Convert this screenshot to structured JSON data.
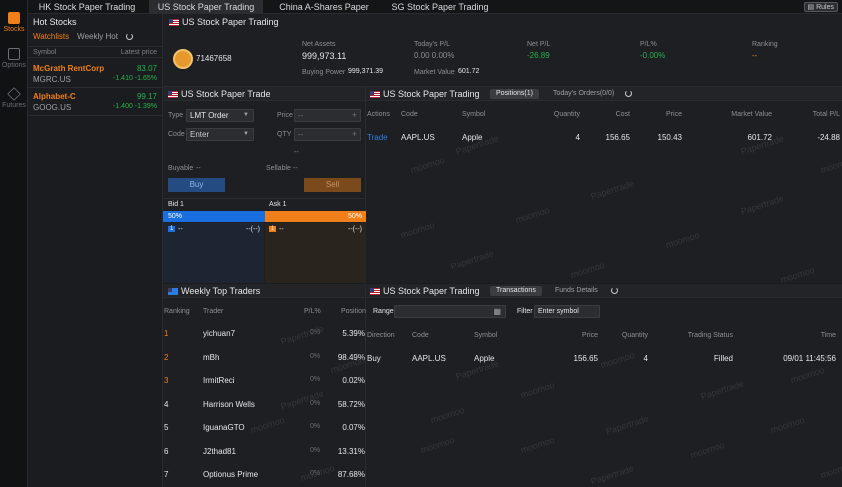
{
  "rail": [
    {
      "label": "Stocks",
      "icon": "stocks-icon",
      "active": true
    },
    {
      "label": "Options",
      "icon": "options-icon",
      "active": false
    },
    {
      "label": "Futures",
      "icon": "futures-icon",
      "active": false
    }
  ],
  "tabs": [
    "HK Stock Paper Trading",
    "US Stock Paper Trading",
    "China A-Shares Paper Trading",
    "SG Stock Paper Trading"
  ],
  "rules_label": "Rules",
  "hot": {
    "title": "Hot Stocks",
    "subtabs": [
      "Watchlists",
      "Weekly Hot"
    ],
    "col_symbol": "Symbol",
    "col_price": "Latest price",
    "stocks": [
      {
        "name": "McGrath RentCorp",
        "code": "MGRC.US",
        "price": "83.07",
        "change": "-1.410 -1.65%"
      },
      {
        "name": "Alphabet-C",
        "code": "GOOG.US",
        "price": "99.17",
        "change": "-1.400 -1.39%"
      }
    ]
  },
  "account": {
    "title": "US Stock Paper Trading",
    "id": "71467658",
    "net_assets_label": "Net Assets",
    "net_assets": "999,973.11",
    "buying_power_label": "Buying Power",
    "buying_power": "999,371.39",
    "todays_pl_label": "Today's P/L",
    "todays_pl": "0.00  0.00%",
    "market_value_label": "Market Value",
    "market_value": "601.72",
    "net_pl_label": "Net P/L",
    "net_pl": "-26.89",
    "pl_pct_label": "P/L%",
    "pl_pct": "-0.00%",
    "ranking_label": "Ranking",
    "ranking": "--"
  },
  "trade": {
    "title": "US Stock Paper Trade",
    "type_label": "Type",
    "type_value": "LMT Order",
    "code_label": "Code",
    "code_placeholder": "Enter",
    "price_label": "Price",
    "qty_label": "QTY",
    "price_value": "--",
    "qty_value": "--",
    "dash": "--",
    "buyable_label": "Buyable",
    "buyable": "--",
    "sellable_label": "Sellable",
    "sellable": "--",
    "buy": "Buy",
    "sell": "Sell",
    "bid_label": "Bid 1",
    "ask_label": "Ask 1",
    "bid_pct": "50%",
    "ask_pct": "50%",
    "bid_ratio": 0.5,
    "ask_ratio": 0.5,
    "bid_num": "1",
    "ask_num": "1",
    "bid_price": "--",
    "bid_size": "--(--)",
    "ask_price": "--",
    "ask_size": "--(--)"
  },
  "positions": {
    "title": "US Stock Paper Trading",
    "tabs": [
      "Positions(1)",
      "Today's Orders(0/0)"
    ],
    "headers": [
      "Actions",
      "Code",
      "Symbol",
      "Quantity",
      "Cost",
      "Price",
      "Market Value",
      "Total P/L"
    ],
    "rows": [
      {
        "action": "Trade",
        "code": "AAPL.US",
        "symbol": "Apple",
        "quantity": "4",
        "cost": "156.65",
        "price": "150.43",
        "market_value": "601.72",
        "total_pl": "-24.88"
      }
    ]
  },
  "traders": {
    "title": "Weekly Top Traders",
    "headers": [
      "Ranking",
      "Trader",
      "P/L%",
      "Position"
    ],
    "rows": [
      {
        "rank": "1",
        "name": "yichuan7",
        "pl": "0%",
        "position": "5.39%"
      },
      {
        "rank": "2",
        "name": "mBh",
        "pl": "0%",
        "position": "98.49%"
      },
      {
        "rank": "3",
        "name": "IrmitReci",
        "pl": "0%",
        "position": "0.02%"
      },
      {
        "rank": "4",
        "name": "Harrison Wells",
        "pl": "0%",
        "position": "58.72%"
      },
      {
        "rank": "5",
        "name": "IguanaGTO",
        "pl": "0%",
        "position": "0.07%"
      },
      {
        "rank": "6",
        "name": "J2thad81",
        "pl": "0%",
        "position": "13.31%"
      },
      {
        "rank": "7",
        "name": "Optionus Prime",
        "pl": "0%",
        "position": "87.68%"
      }
    ]
  },
  "transactions": {
    "title": "US Stock Paper Trading",
    "tabs": [
      "Transactions",
      "Funds Details"
    ],
    "range_label": "Range:",
    "filter_label": "Filter",
    "filter_placeholder": "Enter symbol",
    "headers": [
      "Direction",
      "Code",
      "Symbol",
      "Price",
      "Quantity",
      "Trading Status",
      "Time"
    ],
    "rows": [
      {
        "direction": "Buy",
        "code": "AAPL.US",
        "symbol": "Apple",
        "price": "156.65",
        "quantity": "4",
        "status": "Filled",
        "time": "09/01 11:45:56"
      }
    ]
  },
  "watermarks": [
    "moomoo",
    "Papertrade"
  ],
  "colors": {
    "accent": "#f07f1a",
    "buy": "#2a7de1",
    "up": "#27b24c",
    "bg": "#1e1f22"
  }
}
